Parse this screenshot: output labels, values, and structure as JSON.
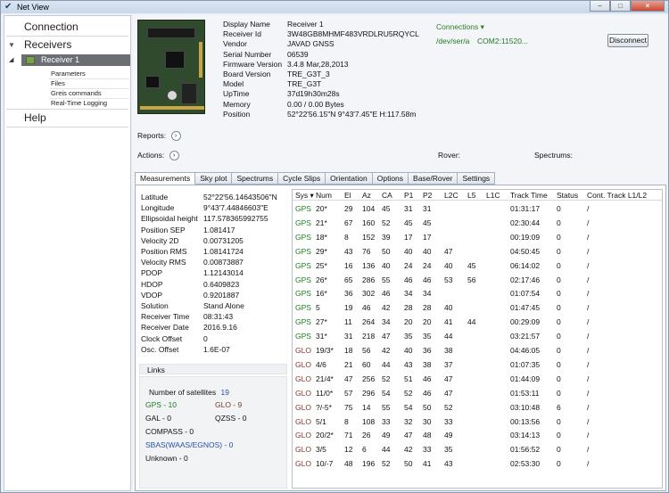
{
  "window": {
    "title": "Net View",
    "minimize": "–",
    "maximize": "□",
    "close": "×"
  },
  "nav": {
    "connection": "Connection",
    "receivers": "Receivers",
    "receiver1": "Receiver 1",
    "subitems": [
      "Parameters",
      "Files",
      "Greis commands",
      "Real-Time Logging"
    ],
    "help": "Help"
  },
  "device_labels": [
    "Display Name",
    "Receiver Id",
    "Vendor",
    "Serial Number",
    "Firmware Version",
    "Board Version",
    "Model",
    "UpTime",
    "Memory",
    "Position"
  ],
  "device_values": [
    "Receiver 1",
    "3W48GB8MHMF483VRDLRU5RQYCL",
    "JAVAD GNSS",
    "06539",
    "3.4.8 Mar,28,2013",
    "TRE_G3T_3",
    "TRE_G3T",
    "37d19h30m28s",
    "0.00 / 0.00 Bytes",
    "52°22'56.15\"N 9°43'7.45\"E H:117.58m"
  ],
  "connections": {
    "label": "Connections",
    "caret": "▾",
    "path": "/dev/ser/a",
    "com": "COM2:11520...",
    "disconnect": "Disconnect"
  },
  "reports": "Reports:",
  "actions": "Actions:",
  "rover": "Rover:",
  "spectrums": "Spectrums:",
  "circ_arrow": "›",
  "tabs": [
    "Measurements",
    "Sky plot",
    "Spectrums",
    "Cycle Slips",
    "Orientation",
    "Options",
    "Base/Rover",
    "Settings"
  ],
  "meas_labels": [
    "Latitude",
    "Longitude",
    "Ellipsoidal height",
    "Position SEP",
    "Velocity 2D",
    "Position RMS",
    "Velocity RMS",
    "PDOP",
    "HDOP",
    "VDOP",
    "Solution",
    "Receiver Time",
    "Receiver Date",
    "Clock Offset",
    "Osc. Offset"
  ],
  "meas_values": [
    "52°22'56.14643506\"N",
    "9°43'7.44846603\"E",
    "117.578365992755",
    "1.081417",
    "0.00731205",
    "1.08141724",
    "0.00873887",
    "1.12143014",
    "0.6409823",
    "0.9201887",
    "Stand Alone",
    "08:31:43",
    "2016.9.16",
    "0",
    "1.6E-07"
  ],
  "links": "Links",
  "satellites": {
    "count_label": "Number of satellites",
    "count": "19",
    "gps": "GPS - 10",
    "glo": "GLO - 9",
    "gal": "GAL - 0",
    "qzss": "QZSS - 0",
    "compass": "COMPASS - 0",
    "sbas": "SBAS(WAAS/EGNOS) - 0",
    "unknown": "Unknown - 0",
    "colors": {
      "gps": "#1f7a1f",
      "glo": "#7a3a2a",
      "sbas": "#2a4fa8",
      "count": "#2a4fa8"
    }
  },
  "grid": {
    "headers": [
      "Sys ▾",
      "Num",
      "El",
      "Az",
      "CA",
      "P1",
      "P2",
      "L2C",
      "L5",
      "L1C",
      "Track Time",
      "Status",
      "Cont. Track L1/L2"
    ],
    "rows": [
      [
        "GPS",
        "20*",
        "29",
        "104",
        "45",
        "31",
        "31",
        "",
        "",
        "",
        "01:31:17",
        "0",
        "/"
      ],
      [
        "GPS",
        "21*",
        "67",
        "160",
        "52",
        "45",
        "45",
        "",
        "",
        "",
        "02:30:44",
        "0",
        "/"
      ],
      [
        "GPS",
        "18*",
        "8",
        "152",
        "39",
        "17",
        "17",
        "",
        "",
        "",
        "00:19:09",
        "0",
        "/"
      ],
      [
        "GPS",
        "29*",
        "43",
        "76",
        "50",
        "40",
        "40",
        "47",
        "",
        "",
        "04:50:45",
        "0",
        "/"
      ],
      [
        "GPS",
        "25*",
        "16",
        "136",
        "40",
        "24",
        "24",
        "40",
        "45",
        "",
        "06:14:02",
        "0",
        "/"
      ],
      [
        "GPS",
        "26*",
        "65",
        "286",
        "55",
        "46",
        "46",
        "53",
        "56",
        "",
        "02:17:46",
        "0",
        "/"
      ],
      [
        "GPS",
        "16*",
        "36",
        "302",
        "46",
        "34",
        "34",
        "",
        "",
        "",
        "01:07:54",
        "0",
        "/"
      ],
      [
        "GPS",
        "5",
        "19",
        "46",
        "42",
        "28",
        "28",
        "40",
        "",
        "",
        "01:47:45",
        "0",
        "/"
      ],
      [
        "GPS",
        "27*",
        "11",
        "264",
        "34",
        "20",
        "20",
        "41",
        "44",
        "",
        "00:29:09",
        "0",
        "/"
      ],
      [
        "GPS",
        "31*",
        "31",
        "218",
        "47",
        "35",
        "35",
        "44",
        "",
        "",
        "03:21:57",
        "0",
        "/"
      ],
      [
        "GLO",
        "19/3*",
        "18",
        "56",
        "42",
        "40",
        "36",
        "38",
        "",
        "",
        "04:46:05",
        "0",
        "/"
      ],
      [
        "GLO",
        "4/6",
        "21",
        "60",
        "44",
        "43",
        "38",
        "37",
        "",
        "",
        "01:07:35",
        "0",
        "/"
      ],
      [
        "GLO",
        "21/4*",
        "47",
        "256",
        "52",
        "51",
        "46",
        "47",
        "",
        "",
        "01:44:09",
        "0",
        "/"
      ],
      [
        "GLO",
        "11/0*",
        "57",
        "296",
        "54",
        "52",
        "46",
        "47",
        "",
        "",
        "01:53:11",
        "0",
        "/"
      ],
      [
        "GLO",
        "?/-5*",
        "75",
        "14",
        "55",
        "54",
        "50",
        "52",
        "",
        "",
        "03:10:48",
        "6",
        "/"
      ],
      [
        "GLO",
        "5/1",
        "8",
        "108",
        "33",
        "32",
        "30",
        "33",
        "",
        "",
        "00:13:56",
        "0",
        "/"
      ],
      [
        "GLO",
        "20/2*",
        "71",
        "26",
        "49",
        "47",
        "48",
        "49",
        "",
        "",
        "03:14:13",
        "0",
        "/"
      ],
      [
        "GLO",
        "3/5",
        "12",
        "6",
        "44",
        "42",
        "33",
        "35",
        "",
        "",
        "01:56:52",
        "0",
        "/"
      ],
      [
        "GLO",
        "10/-7",
        "48",
        "196",
        "52",
        "50",
        "41",
        "43",
        "",
        "",
        "02:53:30",
        "0",
        "/"
      ]
    ]
  }
}
